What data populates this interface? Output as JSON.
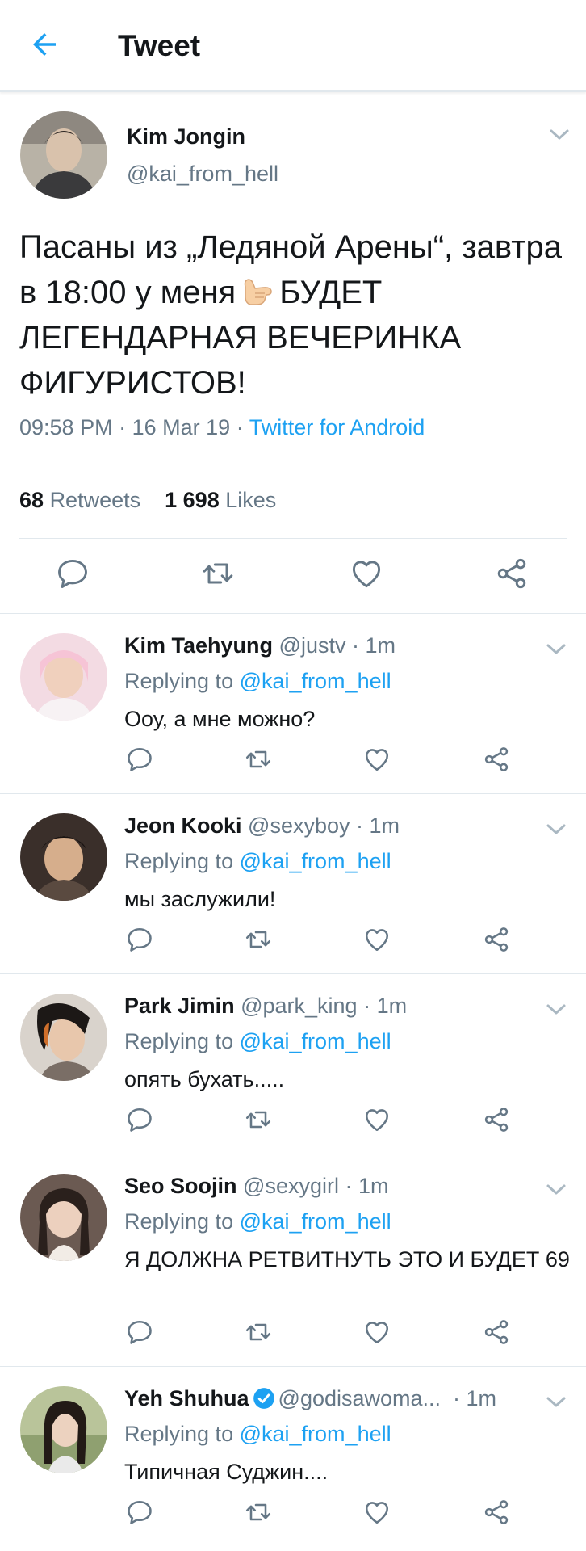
{
  "header": {
    "title": "Tweet"
  },
  "tweet": {
    "name": "Kim Jongin",
    "handle": "@kai_from_hell",
    "text_part1": "Пасаны из „Ледяной Арены“, завтра в 18:00 у меня",
    "emoji": "call-me-hand-emoji",
    "text_part2": "БУДЕТ ЛЕГЕНДАРНАЯ ВЕЧЕРИНКА ФИГУРИСТОВ!",
    "time": "09:58 PM",
    "date": "16 Mar 19",
    "source": "Twitter for Android",
    "retweets_count": "68",
    "retweets_label": "Retweets",
    "likes_count": "1 698",
    "likes_label": "Likes"
  },
  "replies": [
    {
      "name": "Kim Taehyung",
      "handle": "@justv",
      "time": "1m",
      "replying_label": "Replying to",
      "replying_to": "@kai_from_hell",
      "text": "Ооу, а мне можно?",
      "verified": false
    },
    {
      "name": "Jeon Kooki",
      "handle": "@sexyboy",
      "time": "1m",
      "replying_label": "Replying to",
      "replying_to": "@kai_from_hell",
      "text": "мы заслужили!",
      "verified": false
    },
    {
      "name": "Park Jimin",
      "handle": "@park_king",
      "time": "1m",
      "replying_label": "Replying to",
      "replying_to": "@kai_from_hell",
      "text": "опять бухать.....",
      "verified": false
    },
    {
      "name": "Seo Soojin",
      "handle": "@sexygirl",
      "time": "1m",
      "replying_label": "Replying to",
      "replying_to": "@kai_from_hell",
      "text": "Я ДОЛЖНА РЕТВИТНУТЬ ЭТО И БУДЕТ 69",
      "verified": false
    },
    {
      "name": "Yeh Shuhua",
      "handle": "@godisawoma...",
      "time": "1m",
      "replying_label": "Replying to",
      "replying_to": "@kai_from_hell",
      "text": "Типичная Суджин....",
      "verified": true
    }
  ],
  "colors": {
    "accent": "#1da1f2",
    "muted": "#657786",
    "divider": "#e1e8ed",
    "text": "#14171a"
  }
}
